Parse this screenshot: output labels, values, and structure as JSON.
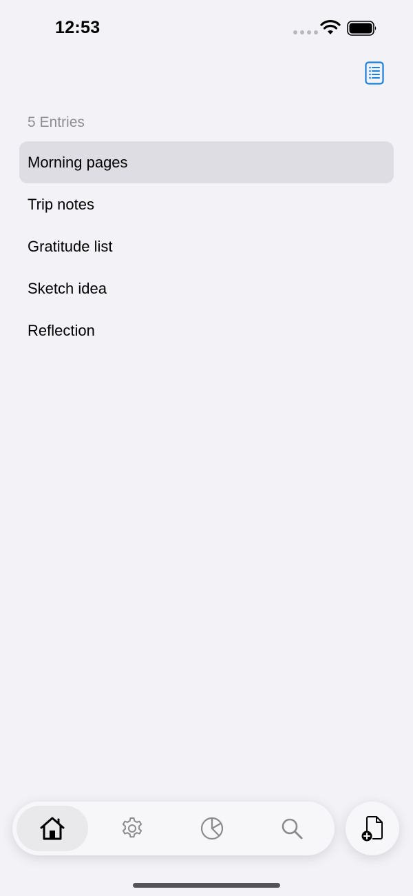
{
  "status_bar": {
    "time": "12:53"
  },
  "header": {
    "list_toggle_icon": "list-document-icon",
    "accent_color": "#1a7fd9"
  },
  "entries": {
    "count_label": "5 Entries",
    "items": [
      {
        "label": "Morning pages",
        "selected": true
      },
      {
        "label": "Trip notes",
        "selected": false
      },
      {
        "label": "Gratitude list",
        "selected": false
      },
      {
        "label": "Sketch idea",
        "selected": false
      },
      {
        "label": "Reflection",
        "selected": false
      }
    ]
  },
  "tab_bar": {
    "tabs": [
      {
        "icon": "house-icon",
        "active": true
      },
      {
        "icon": "gear-icon",
        "active": false
      },
      {
        "icon": "pie-chart-icon",
        "active": false
      },
      {
        "icon": "search-icon",
        "active": false
      }
    ],
    "new_entry_icon": "new-document-icon"
  }
}
